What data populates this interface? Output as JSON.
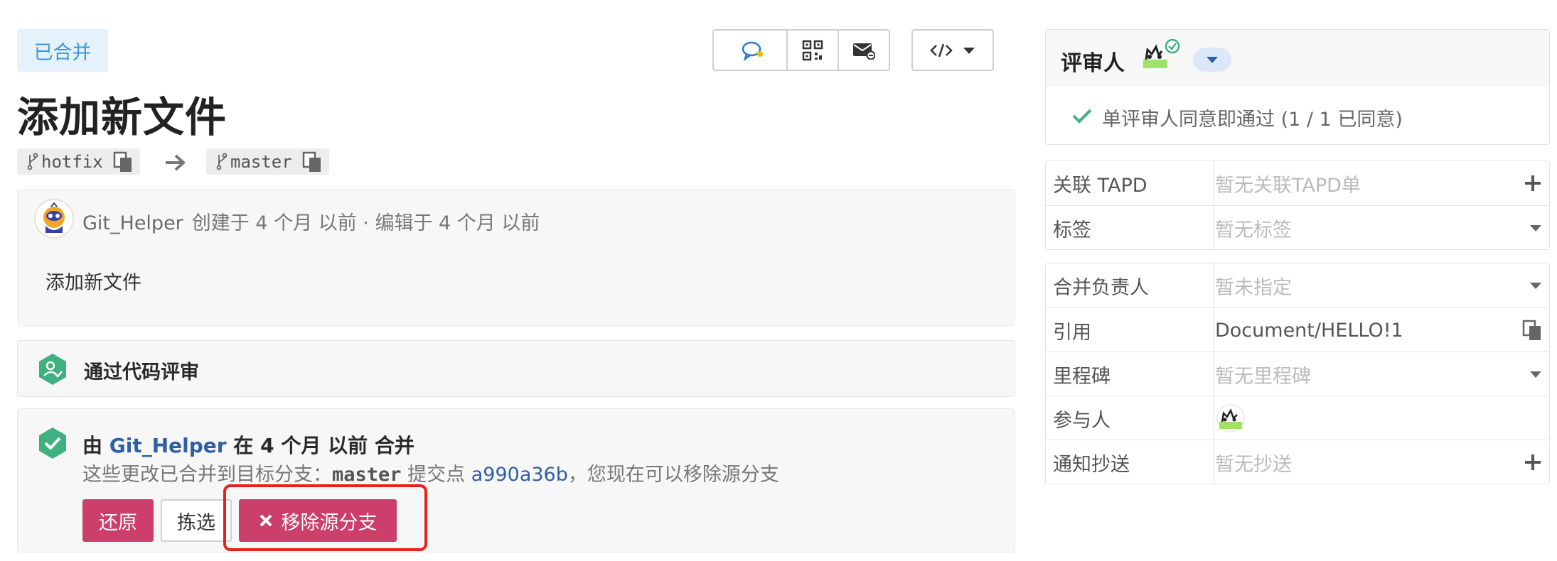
{
  "header": {
    "status_badge": "已合并",
    "title": "添加新文件"
  },
  "branches": {
    "source": "hotfix",
    "target": "master"
  },
  "description": {
    "author": "Git_Helper",
    "meta": "创建于 4 个月 以前 · 编辑于 4 个月 以前",
    "body": "添加新文件"
  },
  "review": {
    "status_text": "通过代码评审"
  },
  "merge": {
    "prefix": "由",
    "author": "Git_Helper",
    "suffix": "在 4 个月 以前 合并",
    "line2_prefix": "这些更改已合并到目标分支：",
    "target_branch": "master",
    "line2_mid": "提交点",
    "commit": "a990a36b",
    "line2_suffix": "，您现在可以移除源分支",
    "revert_label": "还原",
    "cherry_pick_label": "拣选",
    "remove_branch_label": "移除源分支"
  },
  "reviewers": {
    "title": "评审人",
    "status": "单评审人同意即通过 (1 / 1 已同意)"
  },
  "meta_group1": [
    {
      "label": "关联 TAPD",
      "value": "暂无关联TAPD单",
      "action": "plus"
    },
    {
      "label": "标签",
      "value": "暂无标签",
      "action": "caret"
    }
  ],
  "meta_group2": [
    {
      "label": "合并负责人",
      "value": "暂未指定",
      "action": "caret"
    },
    {
      "label": "引用",
      "value": "Document/HELLO!1",
      "action": "copy"
    },
    {
      "label": "里程碑",
      "value": "暂无里程碑",
      "action": "caret"
    },
    {
      "label": "参与人",
      "value": "",
      "action": "none"
    },
    {
      "label": "通知抄送",
      "value": "暂无抄送",
      "action": "plus"
    }
  ],
  "colors": {
    "accent_red": "#cc3f6a",
    "link_blue": "#2f5fa5",
    "success_green": "#3fb07f",
    "badge_blue": "#3b98d3",
    "highlight_red": "#e8211c"
  },
  "icons": [
    "branch-icon",
    "copy-icon",
    "arrow-right-icon",
    "comment-icon",
    "qrcode-icon",
    "mail-icon",
    "code-icon",
    "caret-down-icon",
    "check-icon",
    "reviewer-badge-icon",
    "merged-check-icon",
    "close-icon",
    "plus-icon"
  ]
}
